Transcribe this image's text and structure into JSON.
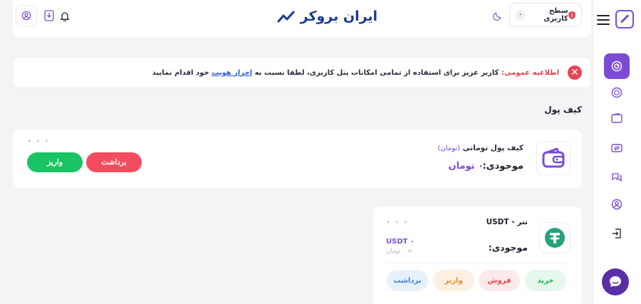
{
  "header": {
    "brand": "ایران بروکر",
    "user_level_label": "سطح کاربری",
    "user_level_value": "۰"
  },
  "notice": {
    "lead": "اطلاعیه عمومی:",
    "text_before_link": " کاربر عزیز برای استفاده از تمامی امکانات پنل کاربری، لطفا نسبت به ",
    "link": "احراز هویت",
    "text_after_link": " خود اقدام نمایید"
  },
  "section_title": "کیف پول",
  "toman_wallet": {
    "name": "کیف پول تومانی",
    "unit_note": "(تومان)",
    "balance_label": "موجودی:",
    "balance_value": "۰ تومان",
    "withdraw_label": "برداشت",
    "deposit_label": "واریز"
  },
  "usdt_wallet": {
    "title": "تتر - USDT",
    "balance_label": "موجودی:",
    "amount": "USDT ۰",
    "toman_equiv": "≈ ۰ تومان",
    "buy_label": "خرید",
    "sell_label": "فروش",
    "deposit_label": "واریز",
    "withdraw_label": "برداشت"
  },
  "colors": {
    "accent": "#7b4bd6",
    "green": "#1ac464",
    "red": "#f24d5f"
  }
}
